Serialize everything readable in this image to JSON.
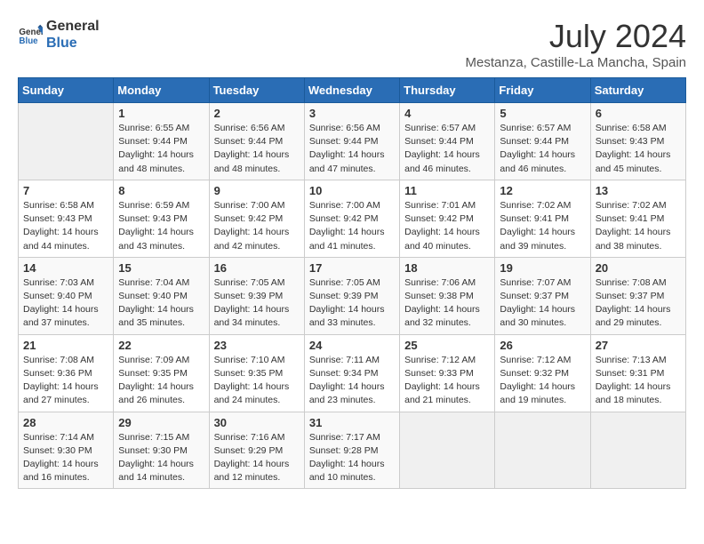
{
  "logo": {
    "text_general": "General",
    "text_blue": "Blue"
  },
  "title": {
    "month_year": "July 2024",
    "location": "Mestanza, Castille-La Mancha, Spain"
  },
  "days_of_week": [
    "Sunday",
    "Monday",
    "Tuesday",
    "Wednesday",
    "Thursday",
    "Friday",
    "Saturday"
  ],
  "weeks": [
    [
      {
        "day": "",
        "sunrise": "",
        "sunset": "",
        "daylight": ""
      },
      {
        "day": "1",
        "sunrise": "Sunrise: 6:55 AM",
        "sunset": "Sunset: 9:44 PM",
        "daylight": "Daylight: 14 hours and 48 minutes."
      },
      {
        "day": "2",
        "sunrise": "Sunrise: 6:56 AM",
        "sunset": "Sunset: 9:44 PM",
        "daylight": "Daylight: 14 hours and 48 minutes."
      },
      {
        "day": "3",
        "sunrise": "Sunrise: 6:56 AM",
        "sunset": "Sunset: 9:44 PM",
        "daylight": "Daylight: 14 hours and 47 minutes."
      },
      {
        "day": "4",
        "sunrise": "Sunrise: 6:57 AM",
        "sunset": "Sunset: 9:44 PM",
        "daylight": "Daylight: 14 hours and 46 minutes."
      },
      {
        "day": "5",
        "sunrise": "Sunrise: 6:57 AM",
        "sunset": "Sunset: 9:44 PM",
        "daylight": "Daylight: 14 hours and 46 minutes."
      },
      {
        "day": "6",
        "sunrise": "Sunrise: 6:58 AM",
        "sunset": "Sunset: 9:43 PM",
        "daylight": "Daylight: 14 hours and 45 minutes."
      }
    ],
    [
      {
        "day": "7",
        "sunrise": "Sunrise: 6:58 AM",
        "sunset": "Sunset: 9:43 PM",
        "daylight": "Daylight: 14 hours and 44 minutes."
      },
      {
        "day": "8",
        "sunrise": "Sunrise: 6:59 AM",
        "sunset": "Sunset: 9:43 PM",
        "daylight": "Daylight: 14 hours and 43 minutes."
      },
      {
        "day": "9",
        "sunrise": "Sunrise: 7:00 AM",
        "sunset": "Sunset: 9:42 PM",
        "daylight": "Daylight: 14 hours and 42 minutes."
      },
      {
        "day": "10",
        "sunrise": "Sunrise: 7:00 AM",
        "sunset": "Sunset: 9:42 PM",
        "daylight": "Daylight: 14 hours and 41 minutes."
      },
      {
        "day": "11",
        "sunrise": "Sunrise: 7:01 AM",
        "sunset": "Sunset: 9:42 PM",
        "daylight": "Daylight: 14 hours and 40 minutes."
      },
      {
        "day": "12",
        "sunrise": "Sunrise: 7:02 AM",
        "sunset": "Sunset: 9:41 PM",
        "daylight": "Daylight: 14 hours and 39 minutes."
      },
      {
        "day": "13",
        "sunrise": "Sunrise: 7:02 AM",
        "sunset": "Sunset: 9:41 PM",
        "daylight": "Daylight: 14 hours and 38 minutes."
      }
    ],
    [
      {
        "day": "14",
        "sunrise": "Sunrise: 7:03 AM",
        "sunset": "Sunset: 9:40 PM",
        "daylight": "Daylight: 14 hours and 37 minutes."
      },
      {
        "day": "15",
        "sunrise": "Sunrise: 7:04 AM",
        "sunset": "Sunset: 9:40 PM",
        "daylight": "Daylight: 14 hours and 35 minutes."
      },
      {
        "day": "16",
        "sunrise": "Sunrise: 7:05 AM",
        "sunset": "Sunset: 9:39 PM",
        "daylight": "Daylight: 14 hours and 34 minutes."
      },
      {
        "day": "17",
        "sunrise": "Sunrise: 7:05 AM",
        "sunset": "Sunset: 9:39 PM",
        "daylight": "Daylight: 14 hours and 33 minutes."
      },
      {
        "day": "18",
        "sunrise": "Sunrise: 7:06 AM",
        "sunset": "Sunset: 9:38 PM",
        "daylight": "Daylight: 14 hours and 32 minutes."
      },
      {
        "day": "19",
        "sunrise": "Sunrise: 7:07 AM",
        "sunset": "Sunset: 9:37 PM",
        "daylight": "Daylight: 14 hours and 30 minutes."
      },
      {
        "day": "20",
        "sunrise": "Sunrise: 7:08 AM",
        "sunset": "Sunset: 9:37 PM",
        "daylight": "Daylight: 14 hours and 29 minutes."
      }
    ],
    [
      {
        "day": "21",
        "sunrise": "Sunrise: 7:08 AM",
        "sunset": "Sunset: 9:36 PM",
        "daylight": "Daylight: 14 hours and 27 minutes."
      },
      {
        "day": "22",
        "sunrise": "Sunrise: 7:09 AM",
        "sunset": "Sunset: 9:35 PM",
        "daylight": "Daylight: 14 hours and 26 minutes."
      },
      {
        "day": "23",
        "sunrise": "Sunrise: 7:10 AM",
        "sunset": "Sunset: 9:35 PM",
        "daylight": "Daylight: 14 hours and 24 minutes."
      },
      {
        "day": "24",
        "sunrise": "Sunrise: 7:11 AM",
        "sunset": "Sunset: 9:34 PM",
        "daylight": "Daylight: 14 hours and 23 minutes."
      },
      {
        "day": "25",
        "sunrise": "Sunrise: 7:12 AM",
        "sunset": "Sunset: 9:33 PM",
        "daylight": "Daylight: 14 hours and 21 minutes."
      },
      {
        "day": "26",
        "sunrise": "Sunrise: 7:12 AM",
        "sunset": "Sunset: 9:32 PM",
        "daylight": "Daylight: 14 hours and 19 minutes."
      },
      {
        "day": "27",
        "sunrise": "Sunrise: 7:13 AM",
        "sunset": "Sunset: 9:31 PM",
        "daylight": "Daylight: 14 hours and 18 minutes."
      }
    ],
    [
      {
        "day": "28",
        "sunrise": "Sunrise: 7:14 AM",
        "sunset": "Sunset: 9:30 PM",
        "daylight": "Daylight: 14 hours and 16 minutes."
      },
      {
        "day": "29",
        "sunrise": "Sunrise: 7:15 AM",
        "sunset": "Sunset: 9:30 PM",
        "daylight": "Daylight: 14 hours and 14 minutes."
      },
      {
        "day": "30",
        "sunrise": "Sunrise: 7:16 AM",
        "sunset": "Sunset: 9:29 PM",
        "daylight": "Daylight: 14 hours and 12 minutes."
      },
      {
        "day": "31",
        "sunrise": "Sunrise: 7:17 AM",
        "sunset": "Sunset: 9:28 PM",
        "daylight": "Daylight: 14 hours and 10 minutes."
      },
      {
        "day": "",
        "sunrise": "",
        "sunset": "",
        "daylight": ""
      },
      {
        "day": "",
        "sunrise": "",
        "sunset": "",
        "daylight": ""
      },
      {
        "day": "",
        "sunrise": "",
        "sunset": "",
        "daylight": ""
      }
    ]
  ]
}
